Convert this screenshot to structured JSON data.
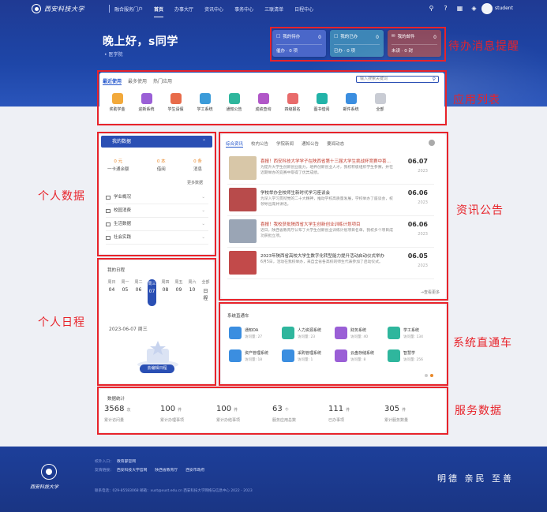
{
  "header": {
    "logo_text": "西安科技大学",
    "nav": [
      "融合服务门户",
      "首页",
      "办事大厅",
      "资讯中心",
      "事务中心",
      "三联清单",
      "日程中心"
    ],
    "username": "student"
  },
  "greeting": {
    "text": "晚上好，s同学",
    "college": "• 医学院"
  },
  "todo_cards": [
    {
      "title": "我的待办",
      "count": "0",
      "foot": "催办 · 0 项"
    },
    {
      "title": "我的已办",
      "count": "0",
      "foot": "已办 · 0 项"
    },
    {
      "title": "我的邮件",
      "count": "0",
      "foot": "未读 · 0 封"
    }
  ],
  "annotations": {
    "todo": "待办消息提醒",
    "apps": "应用列表",
    "personal_data": "个人数据",
    "news": "资讯公告",
    "schedule": "个人日程",
    "sys": "系统直通车",
    "service": "服务数据"
  },
  "apps": {
    "tabs": [
      "最近使用",
      "最多使用",
      "热门应用"
    ],
    "search_placeholder": "输入搜索关键词",
    "items": [
      {
        "label": "奖助学金",
        "color": "#f2a93b"
      },
      {
        "label": "迎新系统",
        "color": "#9a5fd6"
      },
      {
        "label": "学生请假",
        "color": "#e86b4a"
      },
      {
        "label": "学工系统",
        "color": "#3b9bd9"
      },
      {
        "label": "通知公告",
        "color": "#2fb69d"
      },
      {
        "label": "成绩查询",
        "color": "#b157c8"
      },
      {
        "label": "四级报名",
        "color": "#e86b6b"
      },
      {
        "label": "图书借阅",
        "color": "#22b3a8"
      },
      {
        "label": "邮件系统",
        "color": "#3b8ee0"
      },
      {
        "label": "全部",
        "color": "#c9ccd4"
      }
    ]
  },
  "personal": {
    "header": "我的数据",
    "stats": [
      {
        "value": "0 元",
        "label": "一卡通余额"
      },
      {
        "value": "0 本",
        "label": "借阅"
      },
      {
        "value": "0 条",
        "label": "消息"
      }
    ],
    "more": "更多数据",
    "rows": [
      "学业概况",
      "校园消费",
      "生活数据",
      "社会实践"
    ]
  },
  "schedule": {
    "title": "我的日程",
    "days": [
      {
        "w": "周日",
        "d": "04"
      },
      {
        "w": "周一",
        "d": "05"
      },
      {
        "w": "周二",
        "d": "06"
      },
      {
        "w": "周三",
        "d": "07"
      },
      {
        "w": "周四",
        "d": "08"
      },
      {
        "w": "周五",
        "d": "09"
      },
      {
        "w": "周六",
        "d": "10"
      },
      {
        "w": "全部",
        "d": "日程"
      }
    ],
    "date": "2023-06-07 周三",
    "button": "去编辑日程"
  },
  "news": {
    "tabs": [
      "综合资讯",
      "校内公告",
      "学院新闻",
      "通知公告",
      "要闻动态"
    ],
    "items": [
      {
        "title": "喜报！西安科技大学学子在陕西省第十三届大学生挑战杯竞赛中喜获佳绩",
        "summary": "为提升大学生创新创业能力，培养创新创业人才，我校积极组织学生参赛，并在近期举办的竞赛中取得了优异成绩。",
        "day": "06.07",
        "year": "2023",
        "red": true,
        "img": "#d8c7a8"
      },
      {
        "title": "学校举办全校师生新时代学习座谈会",
        "summary": "为深入学习贯彻党的二十大精神，推动学校高质量发展，学校举办了座谈会，校领导出席并讲话。",
        "day": "06.06",
        "year": "2023",
        "red": false,
        "img": "#b84b4b"
      },
      {
        "title": "喜报！我校获批陕西省大学生创新创业训练计划项目",
        "summary": "近日，陕西省教育厅公布了大学生创新创业训练计划项目名单，我校多个项目成功获批立项。",
        "day": "06.06",
        "year": "2023",
        "red": true,
        "img": "#9aa5b5"
      },
      {
        "title": "2023年陕西省高校大学生数字化转型能力提升活动启动仪式举办",
        "summary": "6月5日，活动在我校举办，来自全省各高校的师生代表参加了启动仪式。",
        "day": "06.05",
        "year": "2023",
        "red": false,
        "img": "#c24a4a"
      }
    ],
    "more": "→查看更多"
  },
  "sys": {
    "title": "系统直通车",
    "items": [
      {
        "name": "通知OA",
        "count": "访问量: 27",
        "color": "#3b8ee0"
      },
      {
        "name": "人力资源系统",
        "count": "访问量: 23",
        "color": "#2fb69d"
      },
      {
        "name": "财务系统",
        "count": "访问量: 40",
        "color": "#9a5fd6"
      },
      {
        "name": "学工系统",
        "count": "访问量: 134",
        "color": "#2fb69d"
      },
      {
        "name": "资产管理系统",
        "count": "访问量: 18",
        "color": "#3b8ee0"
      },
      {
        "name": "采购管理系统",
        "count": "访问量: 1",
        "color": "#3b8ee0"
      },
      {
        "name": "云盘存储系统",
        "count": "访问量: 8",
        "color": "#9a5fd6"
      },
      {
        "name": "智慧学",
        "count": "访问量: 256",
        "color": "#2fb69d"
      }
    ]
  },
  "service": {
    "title": "数据统计",
    "items": [
      {
        "value": "3568",
        "unit": "次",
        "label": "累计访问量"
      },
      {
        "value": "100",
        "unit": "件",
        "label": "累计办理事项"
      },
      {
        "value": "100",
        "unit": "件",
        "label": "累计办结事项"
      },
      {
        "value": "63",
        "unit": "个",
        "label": "服务应用总数"
      },
      {
        "value": "111",
        "unit": "件",
        "label": "已办事项"
      },
      {
        "value": "305",
        "unit": "件",
        "label": "累计服务数量"
      }
    ]
  },
  "footer": {
    "logo_text": "西安科技大学",
    "links_label_1": "校外入口：",
    "link_1": "教育部官网",
    "links_label_2": "友情链接：",
    "links_2": [
      "西安科技大学官网",
      "陕西省教育厅",
      "西安市政府"
    ],
    "contact": "联系电话：029-85583068   邮箱：xust@xust.edu.cn   西安科技大学网络与信息中心 2022 - 2023",
    "motto": "明德 亲民 至善"
  }
}
